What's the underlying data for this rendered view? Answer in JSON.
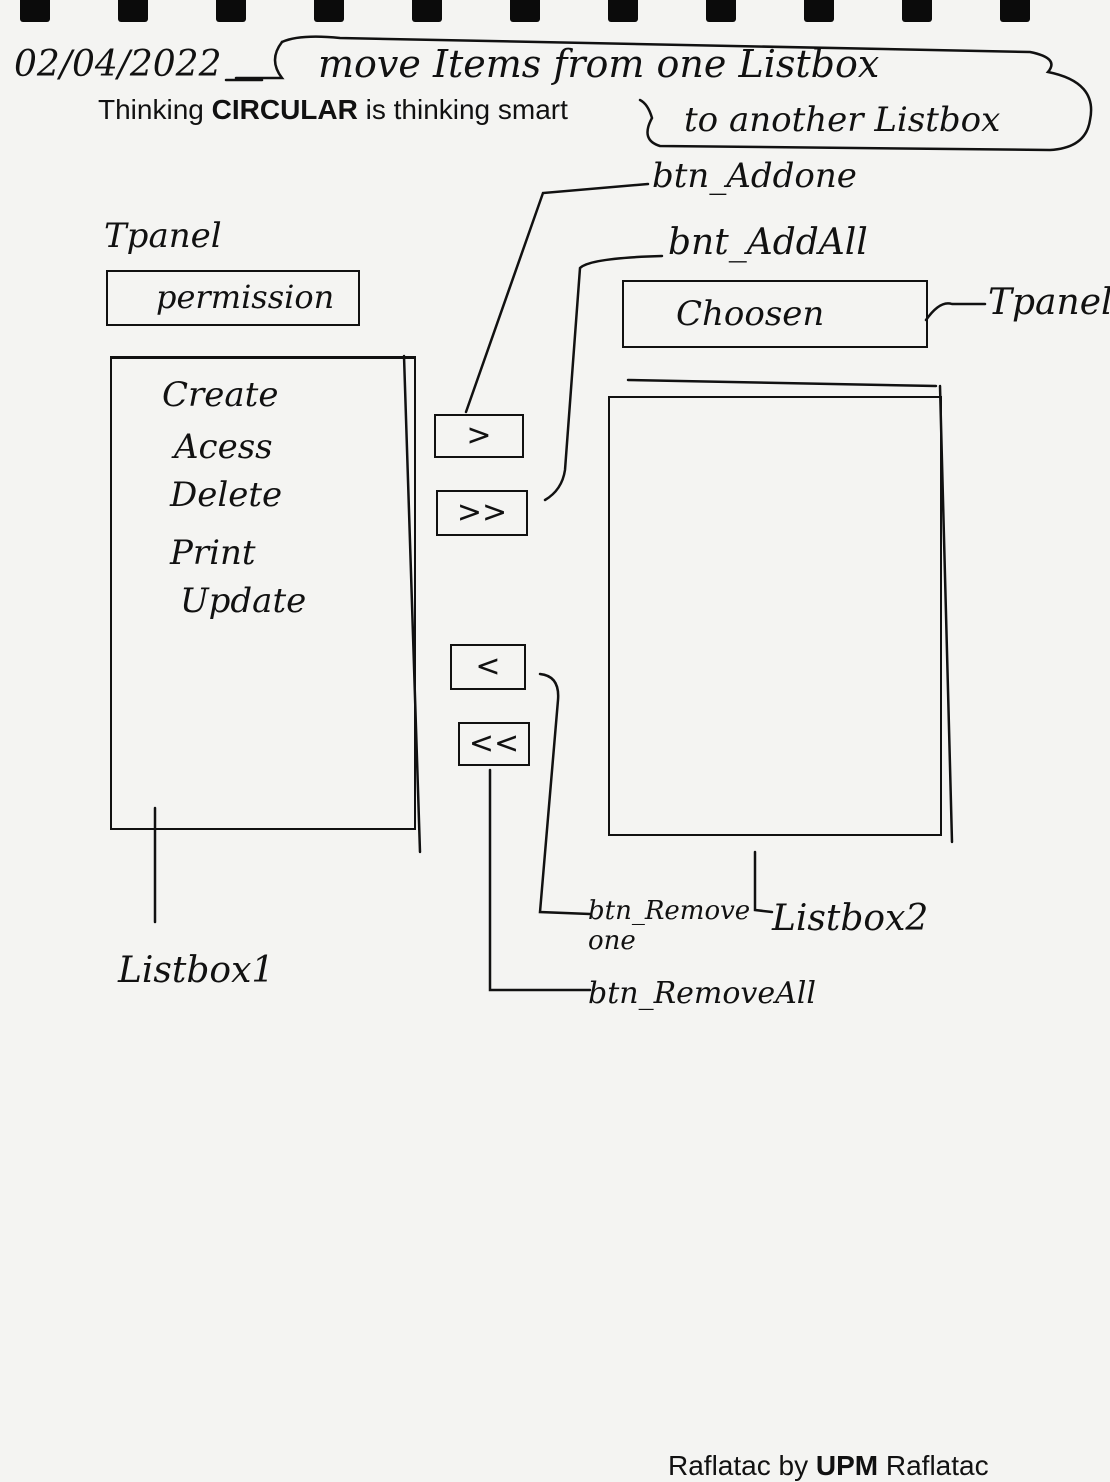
{
  "header": {
    "date": "02/04/2022",
    "printed_tagline_prefix": "Thinking ",
    "printed_tagline_bold": "CIRCULAR",
    "printed_tagline_suffix": " is thinking smart",
    "title_line1": "move Items from one Listbox",
    "title_line2": "to another Listbox"
  },
  "left_panel": {
    "label": "Tpanel",
    "caption": "permission"
  },
  "listbox1": {
    "label": "Listbox1",
    "items": [
      "Create",
      "Acess",
      "Delete",
      "Print",
      "Update"
    ]
  },
  "buttons": {
    "add_one": {
      "symbol": ">",
      "label": "btn_Addone"
    },
    "add_all": {
      "symbol": ">>",
      "label": "bnt_AddAll"
    },
    "remove_one": {
      "symbol": "<",
      "label": "btn_Remove one"
    },
    "remove_all": {
      "symbol": "<<",
      "label": "btn_RemoveAll"
    }
  },
  "right_panel": {
    "label": "Tpanel",
    "caption": "Choosen"
  },
  "listbox2": {
    "label": "Listbox2",
    "items": []
  },
  "footer": {
    "brand_prefix": "Raflatac by ",
    "brand_bold": "UPM",
    "brand_suffix": " Raflatac"
  }
}
